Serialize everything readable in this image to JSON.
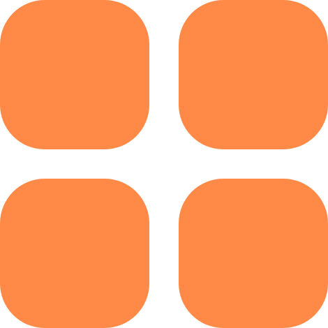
{
  "icon": {
    "name": "grid-apps-icon",
    "color": "#FF8A47",
    "background": "#FFFFFF",
    "tiles": [
      "top-left",
      "top-right",
      "bottom-left",
      "bottom-right"
    ]
  }
}
